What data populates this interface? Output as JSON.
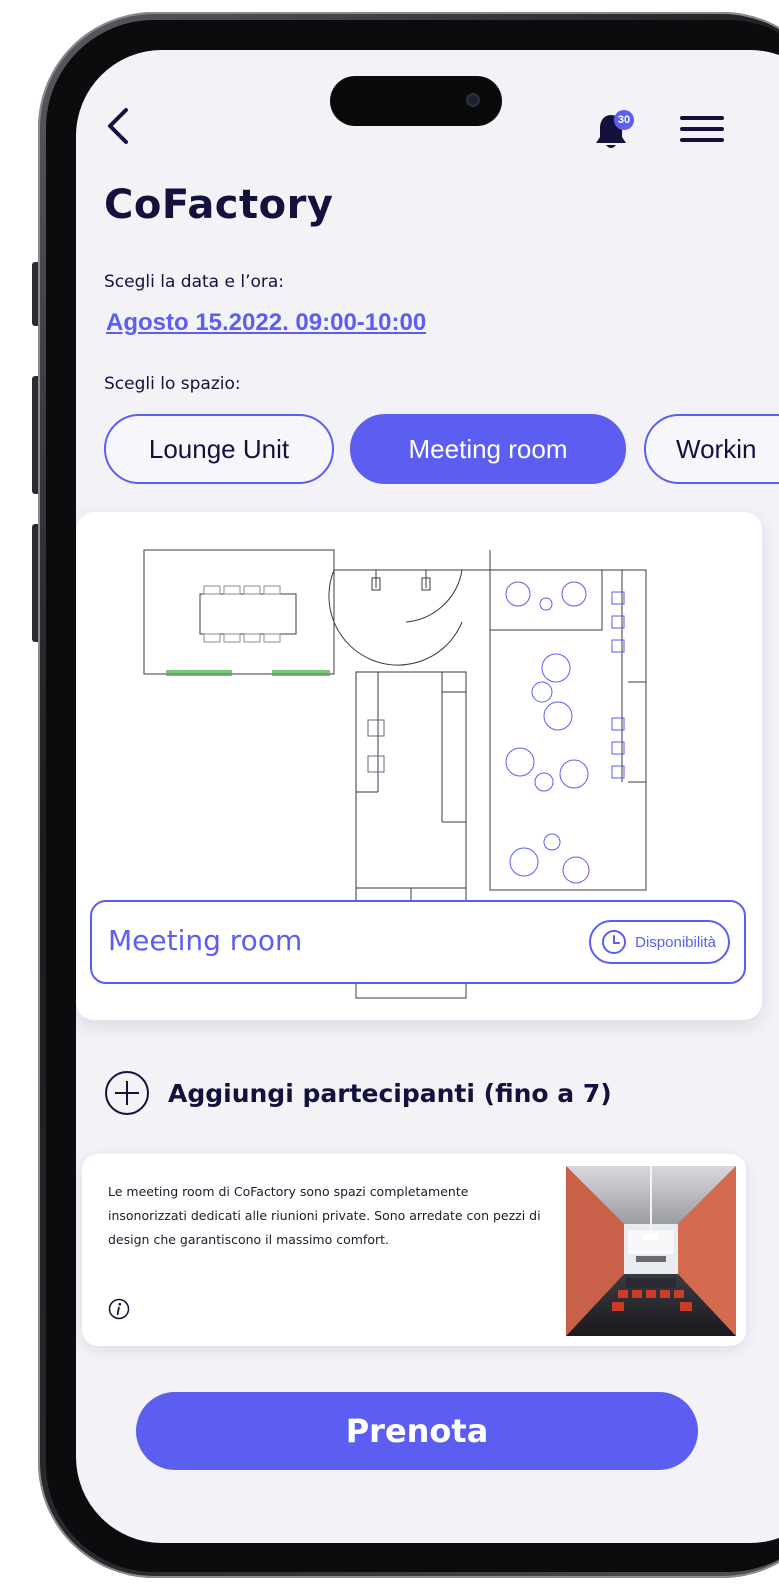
{
  "header": {
    "back_icon": "chevron-left-icon",
    "notification_icon": "bell-icon",
    "notification_count": "30",
    "menu_icon": "hamburger-menu-icon"
  },
  "page": {
    "title": "CoFactory",
    "date_prompt": "Scegli la data e l’ora:",
    "selected_datetime": "Agosto 15.2022. 09:00-10:00",
    "space_prompt": "Scegli lo spazio:"
  },
  "space_tabs": [
    {
      "label": "Lounge Unit",
      "selected": false
    },
    {
      "label": "Meeting room",
      "selected": true
    },
    {
      "label": "Workin",
      "selected": false
    }
  ],
  "map_card": {
    "room_name": "Meeting room",
    "availability_label": "Disponibilità",
    "availability_icon": "clock-icon"
  },
  "participants": {
    "add_icon": "plus-circle-icon",
    "label": "Aggiungi partecipanti (fino a 7)"
  },
  "description": {
    "text": "Le meeting room di CoFactory sono spazi completamente insonorizzati dedicati alle riunioni private. Sono arredate con pezzi di design che garantiscono il massimo comfort.",
    "info_icon": "info-icon"
  },
  "cta": {
    "label": "Prenota"
  },
  "colors": {
    "accent": "#5b5ef0",
    "text_dark": "#14123d",
    "background": "#f2f2f7"
  }
}
